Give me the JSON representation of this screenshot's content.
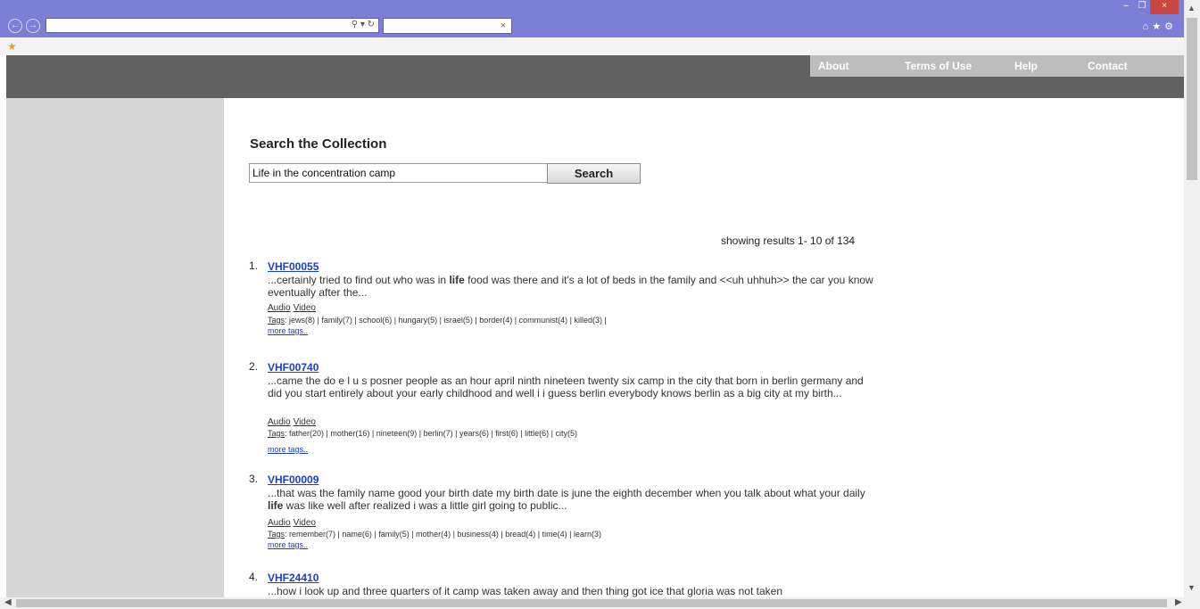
{
  "header": {
    "nav": [
      "About",
      "Terms of Use",
      "Help",
      "Contact"
    ]
  },
  "search": {
    "title": "Search the Collection",
    "value": "Life in the concentration camp",
    "button": "Search"
  },
  "results_count": "showing results 1- 10 of 134",
  "results": [
    {
      "num": "1.",
      "id": "VHF00055",
      "snippet": [
        {
          "t": "...certainly tried to find out who was in "
        },
        {
          "t": "life",
          "b": true
        },
        {
          "t": " food was there and it's a lot of beds in the family   and <<uh   uhhuh>> the car you know  eventually after the..."
        }
      ],
      "audio": "Audio",
      "video": "Video",
      "tags_label": "Tags",
      "tags": ": jews(8) | family(7) | school(6) | hungary(5) | israel(5) | border(4) | communist(4) | killed(3) |",
      "more": "more tags.."
    },
    {
      "num": "2.",
      "id": "VHF00740",
      "snippet": [
        {
          "t": "...came the do e l u s posner people as an hour april ninth nineteen twenty six camp in the city that born in berlin germany and did you start entirely about your early childhood and  well i i guess berlin everybody knows berlin as a big city at my birth..."
        }
      ],
      "audio": "Audio",
      "video": "Video",
      "tags_label": "Tags",
      "tags": ": father(20) | mother(16) | nineteen(9) | berlin(7) | years(6) | first(6) | little(6) | city(5)",
      "more": "more tags.."
    },
    {
      "num": "3.",
      "id": "VHF00009",
      "snippet": [
        {
          "t": "...that was the family name  good your birth date my birth date is june the eighth december when you talk about what your daily "
        },
        {
          "t": "life",
          "b": true
        },
        {
          "t": " was like  well after realized i was a little girl going to public..."
        }
      ],
      "audio": "Audio",
      "video": "Video",
      "tags_label": "Tags",
      "tags": ": remember(7) | name(6) | family(5) | mother(4) | business(4) | bread(4) | time(4) | learn(3)",
      "more": "more tags.."
    },
    {
      "num": "4.",
      "id": "VHF24410",
      "snippet": [
        {
          "t": "...how i look up and three quarters of it camp was taken away and then thing got ice that gloria was not taken"
        }
      ]
    }
  ]
}
